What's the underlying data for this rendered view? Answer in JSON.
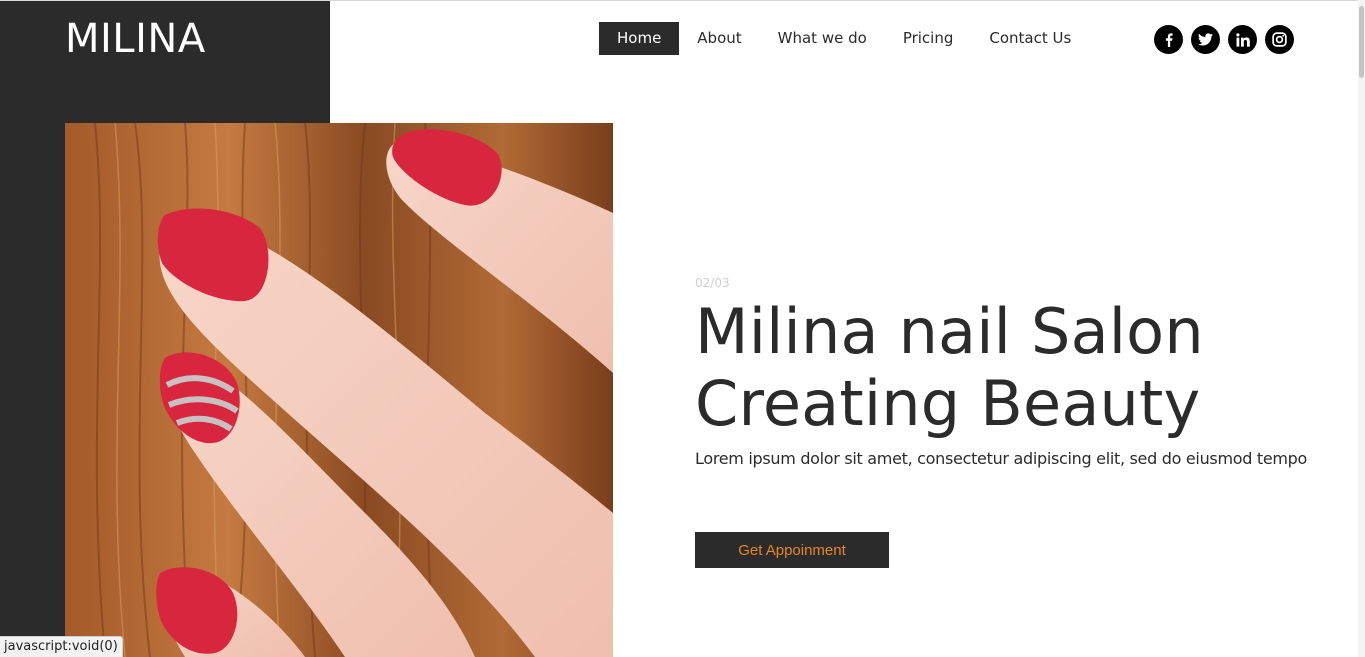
{
  "brand": {
    "logo": "MILINA"
  },
  "nav": {
    "items": [
      {
        "label": "Home",
        "active": true
      },
      {
        "label": "About",
        "active": false
      },
      {
        "label": "What we do",
        "active": false
      },
      {
        "label": "Pricing",
        "active": false
      },
      {
        "label": "Contact Us",
        "active": false
      }
    ]
  },
  "social": {
    "icons": [
      "facebook-icon",
      "twitter-icon",
      "linkedin-icon",
      "instagram-icon"
    ]
  },
  "hero": {
    "slide_counter": "02/03",
    "title_line1": "Milina nail Salon",
    "title_line2": "Creating Beauty",
    "subtitle": "Lorem ipsum dolor sit amet, consectetur adipiscing elit, sed do eiusmod tempo",
    "cta_label": "Get Appoinment",
    "image": "nails-photo"
  },
  "status_bar": {
    "text": "javascript:void(0)"
  },
  "colors": {
    "dark": "#2b2b2b",
    "accent": "#e8871e",
    "nail_red": "#d8263f"
  }
}
